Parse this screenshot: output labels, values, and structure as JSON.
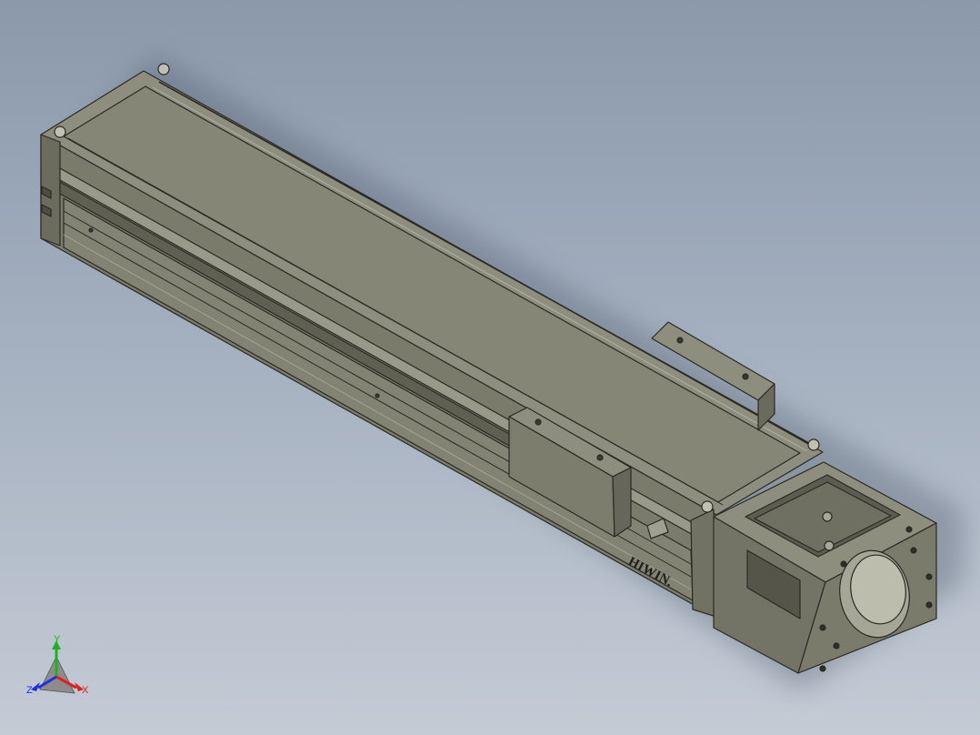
{
  "model": {
    "brand_label": "HIWIN.",
    "colors": {
      "background_top": "#8b99ab",
      "background_bottom": "#c4cbd5",
      "body_light": "#8e8e7e",
      "body_mid": "#7b7b6c",
      "body_dark": "#5f5f52",
      "edge": "#2a2a24"
    }
  },
  "triad": {
    "x_label": "X",
    "y_label": "Y",
    "z_label": "Z",
    "x_color": "#e02020",
    "y_color": "#20b020",
    "z_color": "#2030e0"
  }
}
